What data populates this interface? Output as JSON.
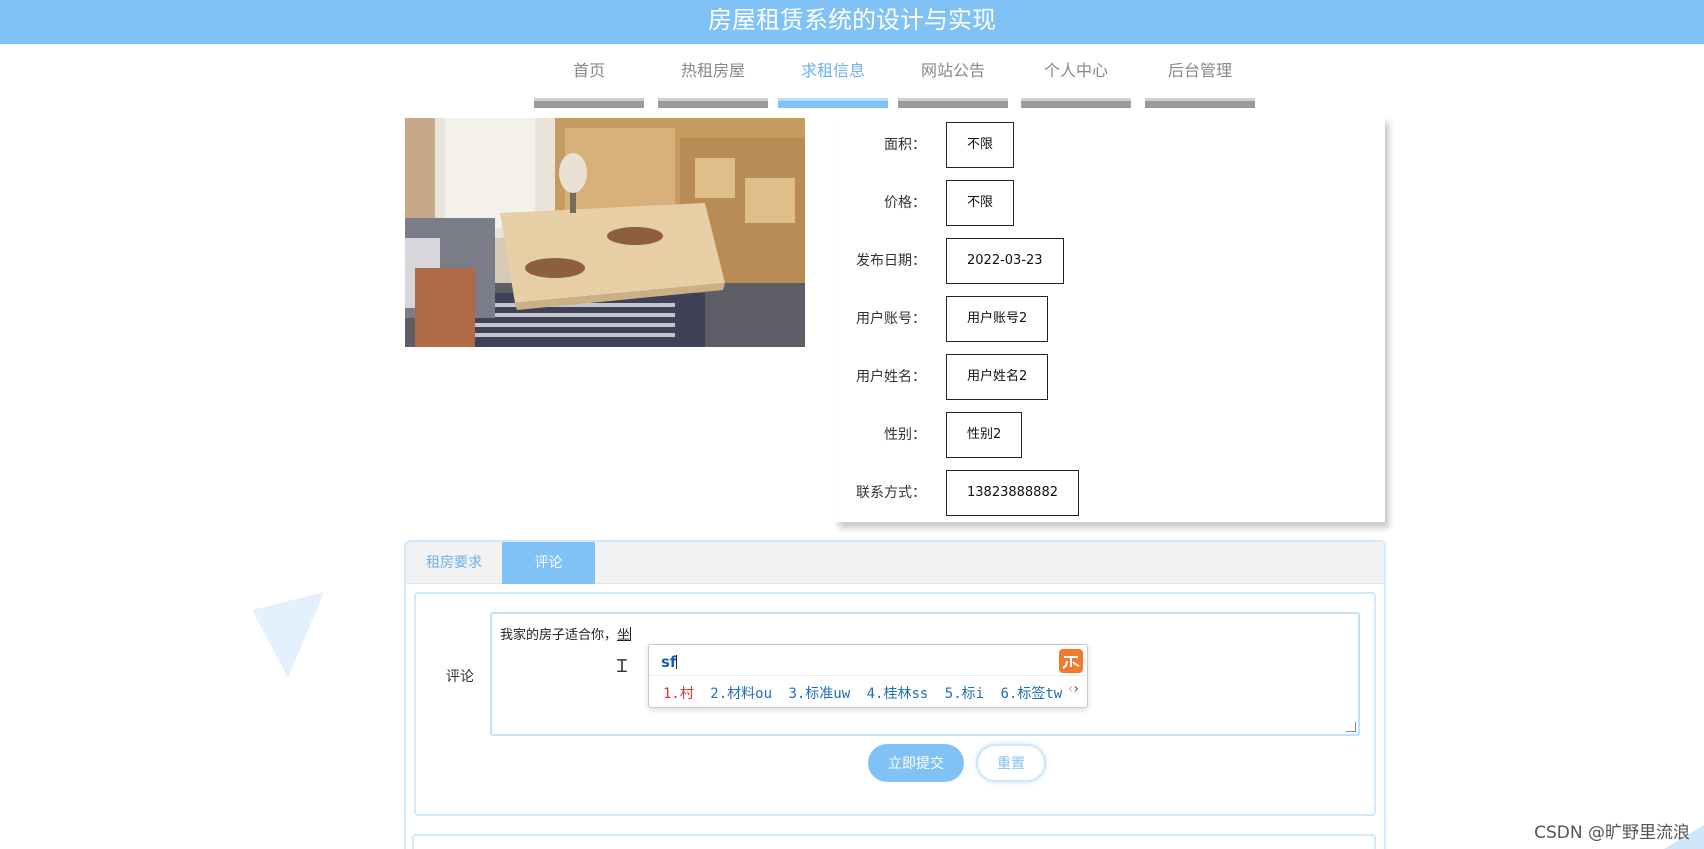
{
  "header": {
    "title": "房屋租赁系统的设计与实现"
  },
  "nav": {
    "items": [
      {
        "label": "首页",
        "active": false
      },
      {
        "label": "热租房屋",
        "active": false
      },
      {
        "label": "求租信息",
        "active": true
      },
      {
        "label": "网站公告",
        "active": false
      },
      {
        "label": "个人中心",
        "active": false
      },
      {
        "label": "后台管理",
        "active": false
      }
    ]
  },
  "detail": {
    "fields": [
      {
        "label": "面积：",
        "value": "不限"
      },
      {
        "label": "价格：",
        "value": "不限"
      },
      {
        "label": "发布日期：",
        "value": "2022-03-23"
      },
      {
        "label": "用户账号：",
        "value": "用户账号2"
      },
      {
        "label": "用户姓名：",
        "value": "用户姓名2"
      },
      {
        "label": "性别：",
        "value": "性别2"
      },
      {
        "label": "联系方式：",
        "value": "13823888882"
      }
    ]
  },
  "tabs": {
    "items": [
      {
        "label": "租房要求",
        "active": false
      },
      {
        "label": "评论",
        "active": true
      }
    ]
  },
  "comment": {
    "label": "评论",
    "text": "我家的房子适合你，",
    "composing": "坐",
    "submit_label": "立即提交",
    "reset_label": "重置"
  },
  "ime": {
    "input": "sf",
    "candidates": [
      "1.村",
      "2.材料ou",
      "3.标准uw",
      "4.桂林ss",
      "5.标i",
      "6.标签tw"
    ]
  },
  "watermark": "CSDN @旷野里流浪",
  "colors": {
    "accent": "#80c2f5",
    "nav_inactive_bar": "#9a9a9a",
    "ime_logo": "#f27a2e"
  }
}
